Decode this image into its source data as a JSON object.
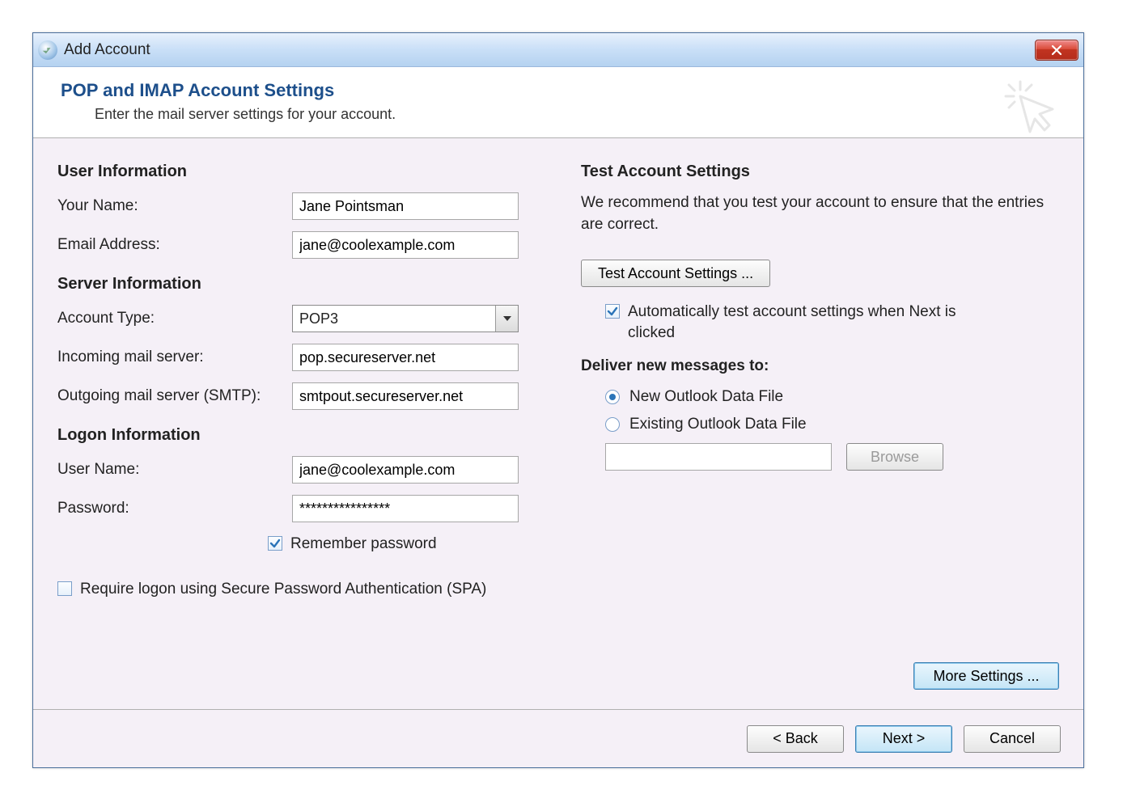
{
  "window": {
    "title": "Add Account"
  },
  "header": {
    "heading": "POP and IMAP Account Settings",
    "subtitle": "Enter the mail server settings for your account."
  },
  "left": {
    "userInfoHeading": "User Information",
    "yourNameLabel": "Your Name:",
    "yourNameValue": "Jane Pointsman",
    "emailLabel": "Email Address:",
    "emailValue": "jane@coolexample.com",
    "serverInfoHeading": "Server Information",
    "accountTypeLabel": "Account Type:",
    "accountTypeValue": "POP3",
    "incomingLabel": "Incoming mail server:",
    "incomingValue": "pop.secureserver.net",
    "outgoingLabel": "Outgoing mail server (SMTP):",
    "outgoingValue": "smtpout.secureserver.net",
    "logonHeading": "Logon Information",
    "usernameLabel": "User Name:",
    "usernameValue": "jane@coolexample.com",
    "passwordLabel": "Password:",
    "passwordValue": "****************",
    "rememberLabel": "Remember password",
    "spaLabel": "Require logon using Secure Password Authentication (SPA)"
  },
  "right": {
    "testHeading": "Test Account Settings",
    "testDesc": "We recommend that you test your account to ensure that the entries are correct.",
    "testButton": "Test Account Settings ...",
    "autoTestLabel": "Automatically test account settings when Next is clicked",
    "deliverHeading": "Deliver new messages to:",
    "newFileLabel": "New Outlook Data File",
    "existingFileLabel": "Existing Outlook Data File",
    "existingFileValue": "",
    "browseButton": "Browse",
    "moreSettings": "More Settings ..."
  },
  "footer": {
    "back": "< Back",
    "next": "Next >",
    "cancel": "Cancel"
  }
}
